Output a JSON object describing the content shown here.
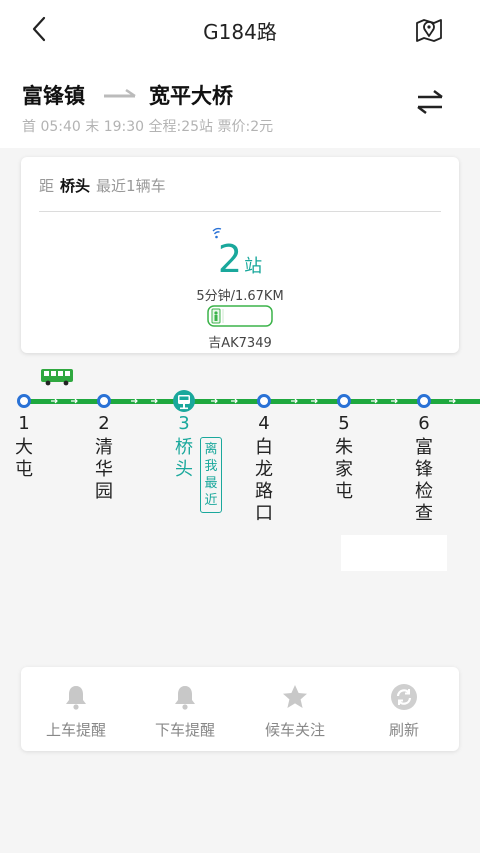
{
  "header": {
    "title": "G184路",
    "from": "富锋镇",
    "to": "宽平大桥",
    "info": "首 05:40 末 19:30 全程:25站  票价:2元"
  },
  "card": {
    "prefix": "距",
    "station": "桥头",
    "suffix": "最近1辆车",
    "eta_num": "2",
    "eta_unit": "站",
    "eta_detail": "5分钟/1.67KM",
    "plate": "吉AK7349"
  },
  "stops": [
    {
      "n": "1",
      "name": "大屯"
    },
    {
      "n": "2",
      "name": "清华园"
    },
    {
      "n": "3",
      "name": "桥头"
    },
    {
      "n": "4",
      "name": "白龙路口"
    },
    {
      "n": "5",
      "name": "朱家屯"
    },
    {
      "n": "6",
      "name": "富锋检查"
    }
  ],
  "nearest_tag": "离我最近",
  "toolbar": {
    "board": "上车提醒",
    "alight": "下车提醒",
    "follow": "候车关注",
    "refresh": "刷新"
  },
  "colors": {
    "accent": "#1aa89c",
    "line": "#1ea83e",
    "stop": "#2a72d6"
  },
  "icons": [
    "back-icon",
    "map-pin-icon",
    "swap-icon",
    "signal-icon",
    "bus-icon",
    "bell-icon",
    "star-icon",
    "refresh-icon"
  ]
}
